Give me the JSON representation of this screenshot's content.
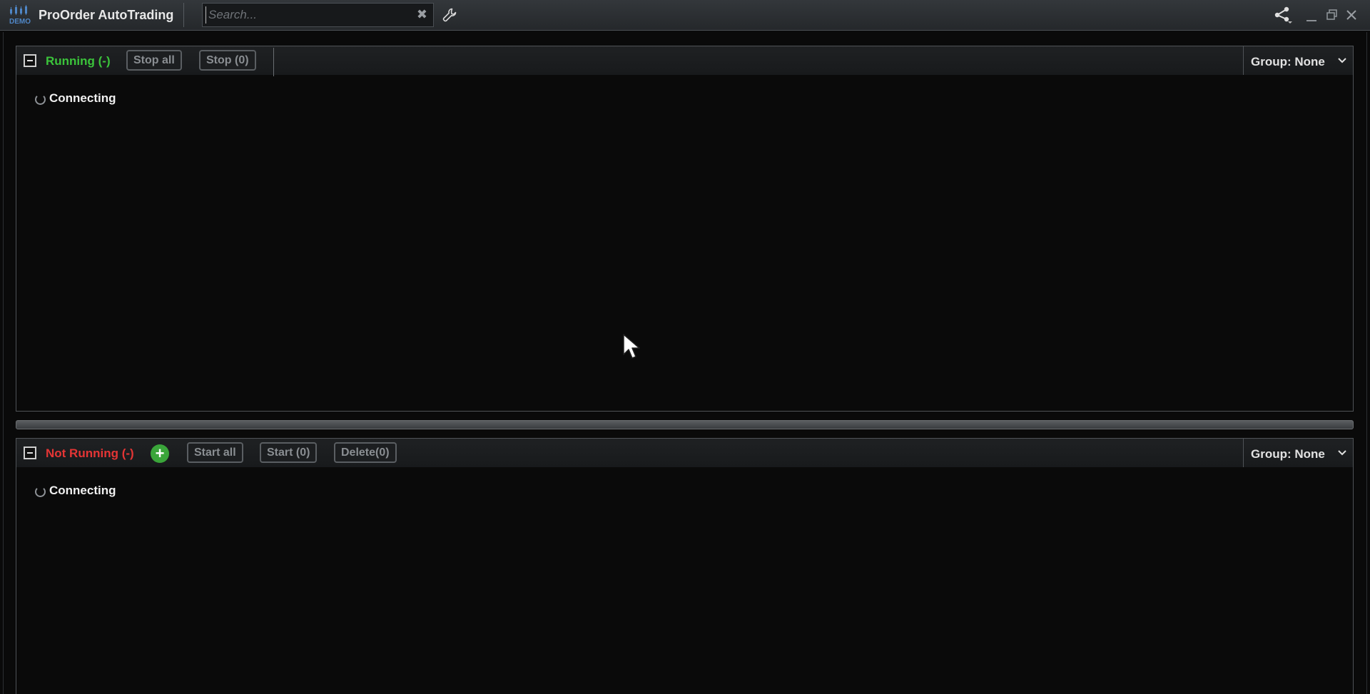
{
  "window": {
    "title": "ProOrder AutoTrading",
    "logo_icon": "demo-logo-icon",
    "logo_text": "DEMO"
  },
  "search": {
    "value": "",
    "placeholder": "Search...",
    "clear_icon": "close-x-icon",
    "clear_glyph": "✖"
  },
  "toolbar": {
    "settings_icon": "wrench-icon",
    "share_icon": "share-icon",
    "minimize_icon": "minimize-icon",
    "restore_icon": "restore-icon",
    "close_icon": "close-icon"
  },
  "running_panel": {
    "title": "Running (-)",
    "title_color": "#3bc43b",
    "buttons": {
      "stop_all": "Stop all",
      "stop_selected": "Stop (0)"
    },
    "group_label": "Group: None",
    "status_text": "Connecting"
  },
  "not_running_panel": {
    "title": "Not Running (-)",
    "title_color": "#e53535",
    "add_glyph": "+",
    "buttons": {
      "start_all": "Start all",
      "start_selected": "Start (0)",
      "delete_selected": "Delete(0)"
    },
    "group_label": "Group: None",
    "status_text": "Connecting"
  },
  "colors": {
    "background": "#0a0a0a",
    "titlebar": "#2c3033",
    "running": "#3bc43b",
    "not_running": "#e53535",
    "add_button": "#3aa53a"
  }
}
